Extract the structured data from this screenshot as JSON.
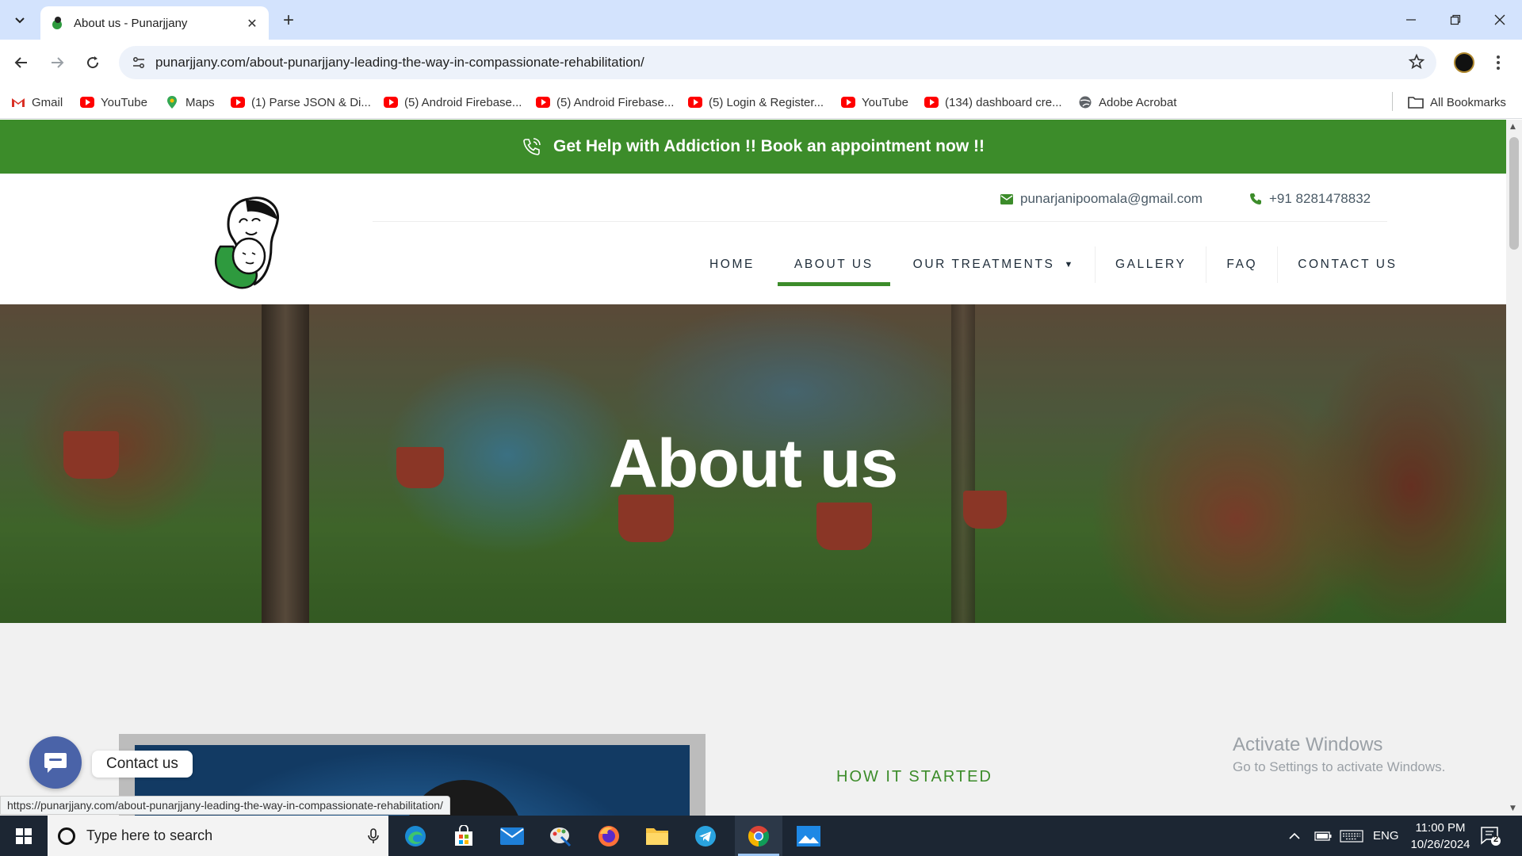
{
  "browser": {
    "tab_title": "About us - Punarjjany",
    "url": "punarjjany.com/about-punarjjany-leading-the-way-in-compassionate-rehabilitation/",
    "bookmarks": [
      {
        "label": "Gmail",
        "icon": "gmail-icon"
      },
      {
        "label": "YouTube",
        "icon": "youtube-icon"
      },
      {
        "label": "Maps",
        "icon": "maps-icon"
      },
      {
        "label": "(1) Parse JSON & Di...",
        "icon": "youtube-icon"
      },
      {
        "label": "(5) Android Firebase...",
        "icon": "youtube-icon"
      },
      {
        "label": "(5) Android Firebase...",
        "icon": "youtube-icon"
      },
      {
        "label": "(5) Login & Register...",
        "icon": "youtube-icon"
      },
      {
        "label": "YouTube",
        "icon": "youtube-icon"
      },
      {
        "label": "(134) dashboard cre...",
        "icon": "youtube-icon"
      },
      {
        "label": "Adobe Acrobat",
        "icon": "globe-icon"
      }
    ],
    "all_bookmarks": "All Bookmarks"
  },
  "page": {
    "banner": "Get Help with Addiction !! Book an appointment now !!",
    "email": "punarjanipoomala@gmail.com",
    "phone": "+91 8281478832",
    "menu": {
      "home": "HOME",
      "about": "ABOUT US",
      "treatments": "OUR TREATMENTS",
      "gallery": "GALLERY",
      "faq": "FAQ",
      "contact": "CONTACT US"
    },
    "active_menu": "ABOUT US",
    "hero_title": "About us",
    "section_heading": "HOW IT STARTED",
    "chat_label": "Contact us",
    "status_url": "https://punarjjany.com/about-punarjjany-leading-the-way-in-compassionate-rehabilitation/",
    "watermark": {
      "line1": "Activate Windows",
      "line2": "Go to Settings to activate Windows."
    }
  },
  "taskbar": {
    "search_placeholder": "Type here to search",
    "language": "ENG",
    "time": "11:00 PM",
    "date": "10/26/2024",
    "notification_count": "2"
  },
  "colors": {
    "brand_green": "#3c8c2a",
    "chrome_tabstrip": "#d3e3fd",
    "chat_button": "#4a63a8"
  }
}
